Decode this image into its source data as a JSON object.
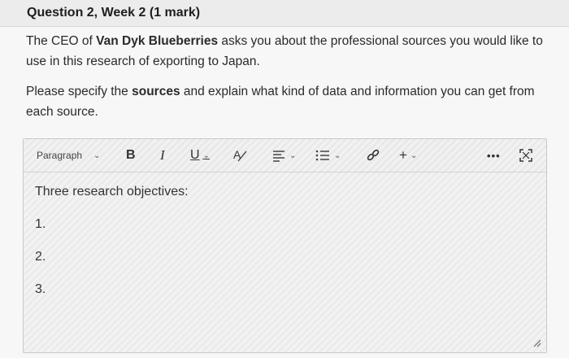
{
  "question": {
    "title": "Question 2, Week 2 (1 mark)",
    "p1_a": "The CEO of ",
    "p1_company": "Van Dyk Blueberries",
    "p1_b": " asks you about the professional sources you would like to use in this research of exporting to Japan.",
    "p2_a": "Please specify the ",
    "p2_sources": "sources",
    "p2_b": " and explain what kind of data and information you can get from each source."
  },
  "toolbar": {
    "paragraph_label": "Paragraph",
    "bold_label": "B",
    "italic_label": "I",
    "underline_label": "U",
    "color_label": "A",
    "plus_label": "+",
    "more_label": "•••",
    "icons": [
      "chevron-down-icon",
      "align-icon",
      "list-icon",
      "link-icon",
      "more-icon",
      "fullscreen-icon"
    ]
  },
  "editor": {
    "heading": "Three research objectives:",
    "items": [
      "1.",
      "2.",
      "3."
    ]
  }
}
